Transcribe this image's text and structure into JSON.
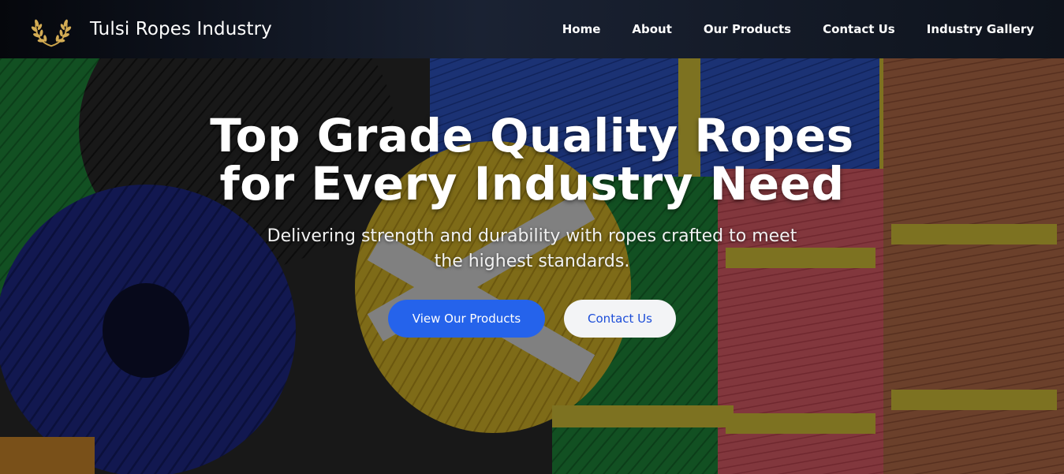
{
  "brand": {
    "name": "Tulsi Ropes Industry",
    "logo_icon": "laurel-wreath-icon"
  },
  "nav": {
    "items": [
      {
        "label": "Home"
      },
      {
        "label": "About"
      },
      {
        "label": "Our Products"
      },
      {
        "label": "Contact Us"
      },
      {
        "label": "Industry Gallery"
      }
    ]
  },
  "hero": {
    "title_line1": "Top Grade Quality Ropes",
    "title_line2": "for Every Industry Need",
    "subtitle": "Delivering strength and durability with ropes crafted to meet the highest standards.",
    "primary_button": "View Our Products",
    "secondary_button": "Contact Us"
  },
  "colors": {
    "accent": "#2563eb",
    "secondary_button_bg": "#f3f4f6",
    "navbar_bg": "#111827"
  }
}
